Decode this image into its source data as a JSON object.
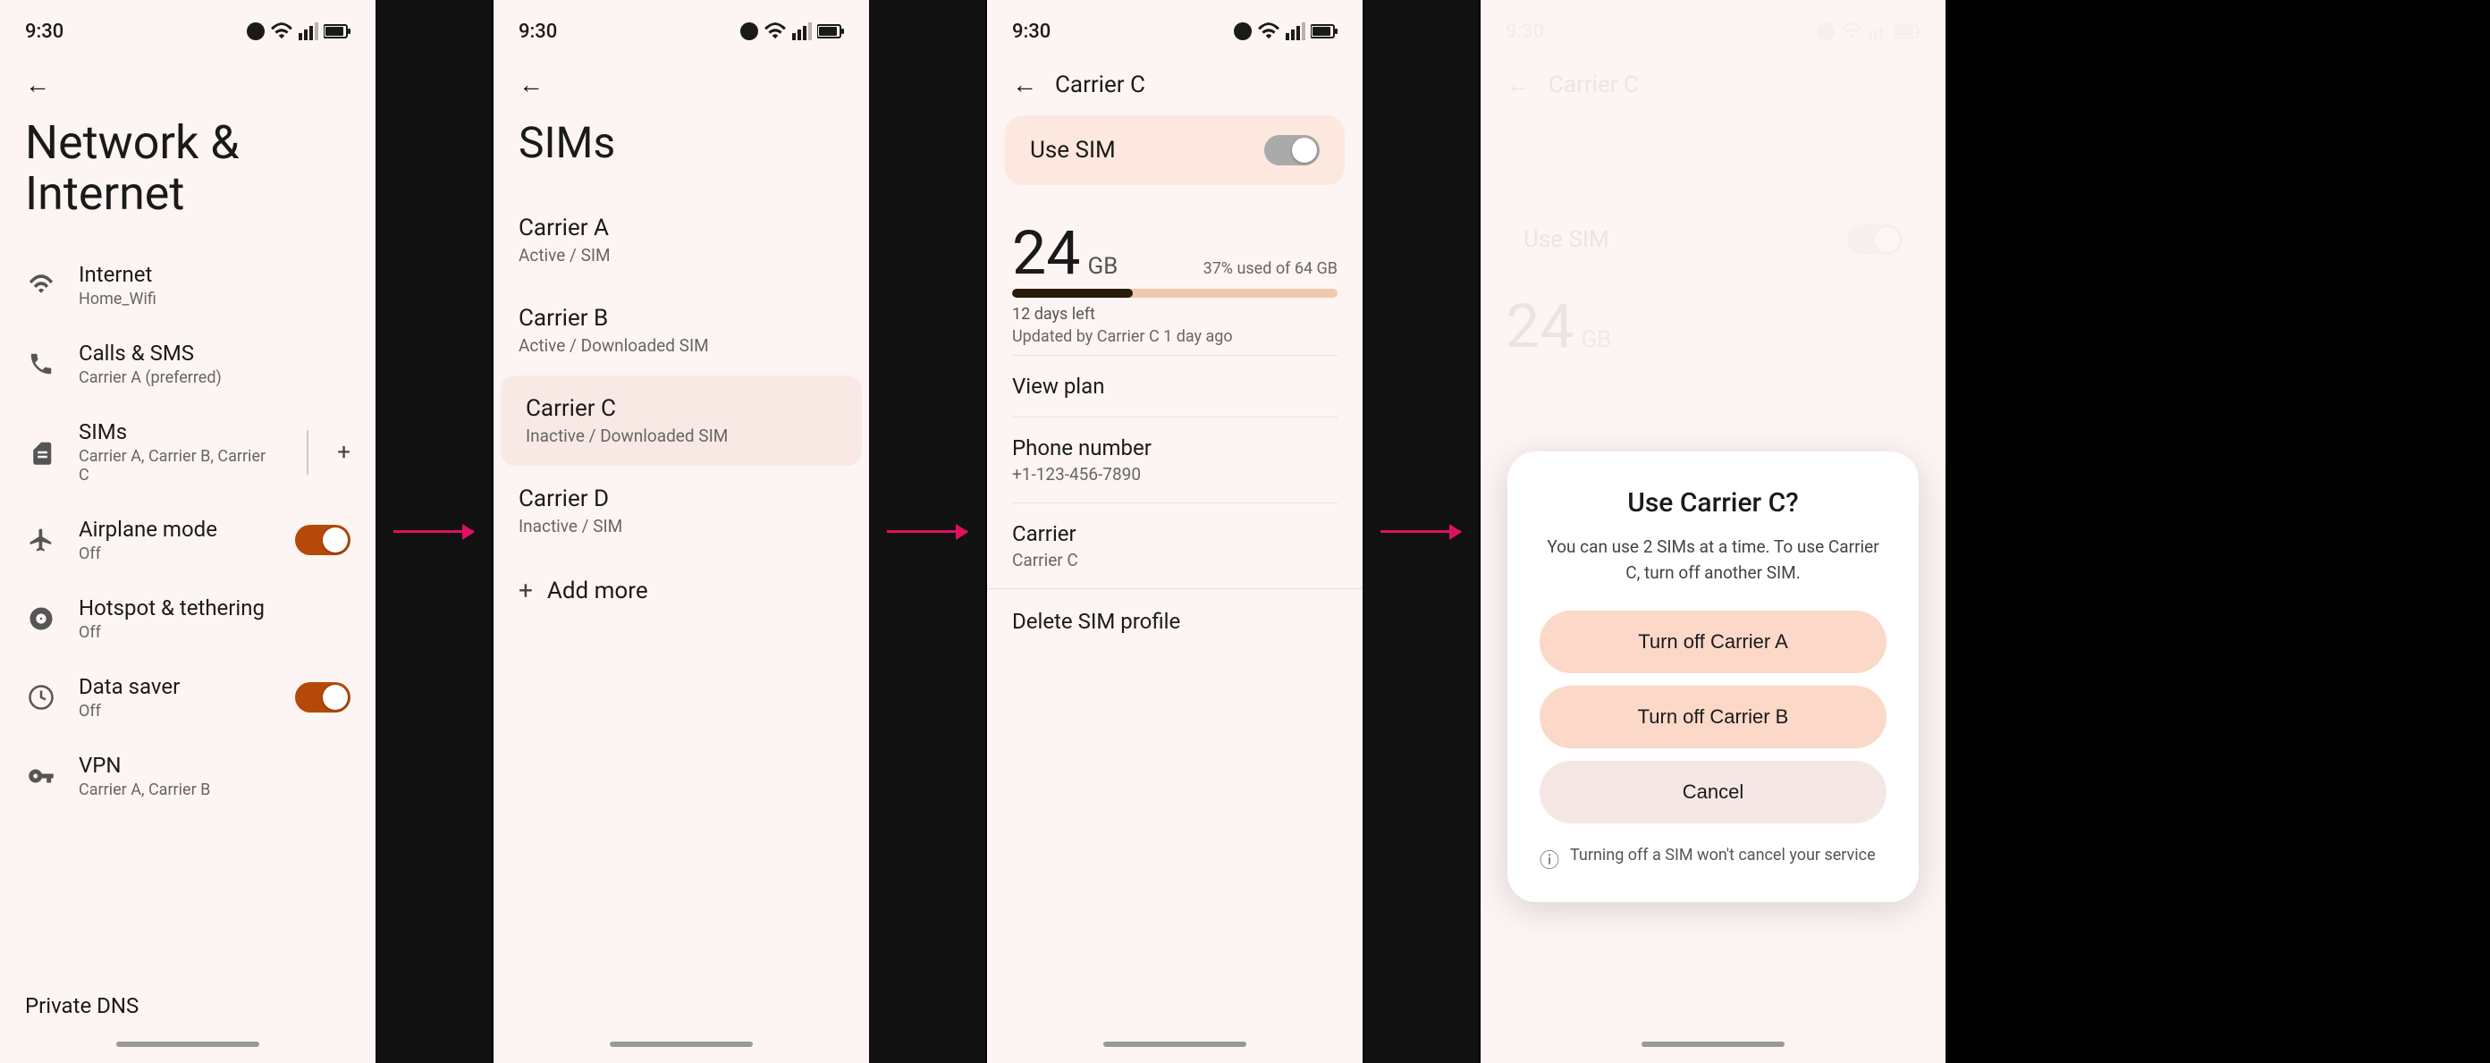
{
  "screens": [
    {
      "id": "network-internet",
      "status_time": "9:30",
      "title": "Network & Internet",
      "menu_items": [
        {
          "id": "internet",
          "label": "Internet",
          "sublabel": "Home_Wifi",
          "icon": "wifi"
        },
        {
          "id": "calls-sms",
          "label": "Calls & SMS",
          "sublabel": "Carrier A (preferred)",
          "icon": "phone"
        },
        {
          "id": "sims",
          "label": "SIMs",
          "sublabel": "Carrier A, Carrier B, Carrier C",
          "icon": "sim",
          "has_divider": true,
          "has_plus": true
        },
        {
          "id": "airplane-mode",
          "label": "Airplane mode",
          "sublabel": "Off",
          "icon": "airplane",
          "toggle": true,
          "toggle_state": "on"
        },
        {
          "id": "hotspot-tethering",
          "label": "Hotspot & tethering",
          "sublabel": "Off",
          "icon": "hotspot"
        },
        {
          "id": "data-saver",
          "label": "Data saver",
          "sublabel": "Off",
          "icon": "data-saver",
          "toggle": true,
          "toggle_state": "on"
        },
        {
          "id": "vpn",
          "label": "VPN",
          "sublabel": "Carrier A, Carrier B",
          "icon": "vpn"
        }
      ],
      "bottom_item": "Private DNS"
    },
    {
      "id": "sims",
      "status_time": "9:30",
      "title": "SIMs",
      "carriers": [
        {
          "name": "Carrier A",
          "status": "Active / SIM",
          "highlighted": false
        },
        {
          "name": "Carrier B",
          "status": "Active / Downloaded SIM",
          "highlighted": false
        },
        {
          "name": "Carrier C",
          "status": "Inactive / Downloaded SIM",
          "highlighted": true
        },
        {
          "name": "Carrier D",
          "status": "Inactive / SIM",
          "highlighted": false
        }
      ],
      "add_more": "Add more"
    },
    {
      "id": "carrier-c",
      "status_time": "9:30",
      "title": "Carrier C",
      "use_sim_label": "Use SIM",
      "data_gb": "24",
      "data_unit": "GB",
      "data_usage": "37% used of 64 GB",
      "data_days": "12 days left",
      "data_updated": "Updated by Carrier C 1 day ago",
      "data_bar_pct": 37,
      "view_plan": "View plan",
      "phone_number_label": "Phone number",
      "phone_number_value": "+1-123-456-7890",
      "carrier_label": "Carrier",
      "carrier_value": "Carrier C",
      "delete_profile": "Delete SIM profile"
    },
    {
      "id": "carrier-c-dialog",
      "status_time": "9:30",
      "title": "Carrier C",
      "use_sim_label": "Use SIM",
      "data_gb": "24",
      "dialog": {
        "title": "Use Carrier C?",
        "body": "You can use 2 SIMs at a time. To use Carrier C, turn off another SIM.",
        "btn_turn_off_a": "Turn off Carrier A",
        "btn_turn_off_b": "Turn off Carrier B",
        "btn_cancel": "Cancel",
        "footer": "Turning off a SIM won't cancel your service"
      }
    }
  ],
  "arrows": [
    {
      "from": "screen1",
      "to": "screen2"
    },
    {
      "from": "screen2",
      "to": "screen3"
    }
  ]
}
